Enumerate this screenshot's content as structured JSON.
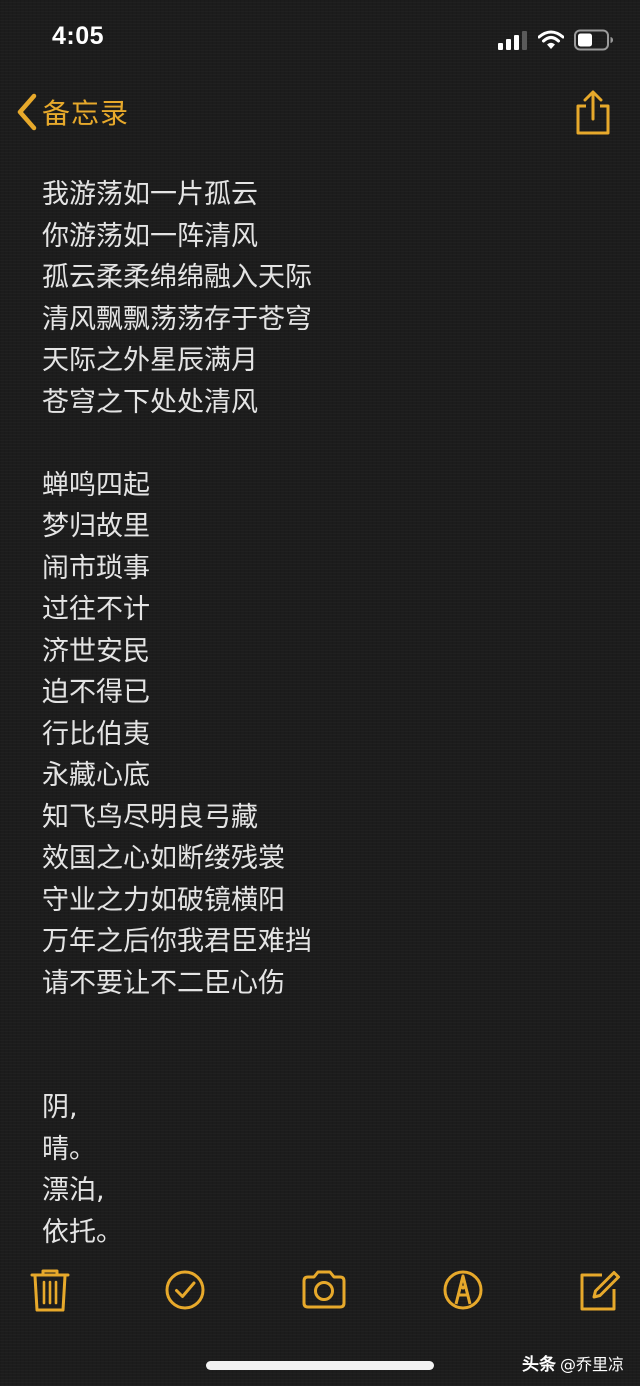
{
  "status_bar": {
    "time": "4:05",
    "icons": [
      "signal-icon",
      "wifi-icon",
      "battery-icon"
    ]
  },
  "nav": {
    "back_label": "备忘录",
    "back_icon": "chevron-left-icon",
    "share_icon": "share-icon"
  },
  "note": {
    "lines": [
      "我游荡如一片孤云",
      "你游荡如一阵清风",
      "孤云柔柔绵绵融入天际",
      "清风飘飘荡荡存于苍穹",
      "天际之外星辰满月",
      "苍穹之下处处清风",
      "",
      "蝉鸣四起",
      "梦归故里",
      "闹市琐事",
      "过往不计",
      "济世安民",
      "迫不得已",
      "行比伯夷",
      "永藏心底",
      "知飞鸟尽明良弓藏",
      "效国之心如断缕残裳",
      "守业之力如破镜横阳",
      "万年之后你我君臣难挡",
      "请不要让不二臣心伤",
      "",
      "",
      "阴,",
      "晴。",
      "漂泊,",
      "依托。"
    ]
  },
  "toolbar": {
    "items": [
      "trash-icon",
      "checklist-icon",
      "camera-icon",
      "markup-icon",
      "compose-icon"
    ]
  },
  "watermark": {
    "brand": "头条",
    "handle": "@乔里凉"
  },
  "colors": {
    "accent": "#e7a92b",
    "background": "#1c1c1c",
    "text": "#e4e4e4"
  }
}
